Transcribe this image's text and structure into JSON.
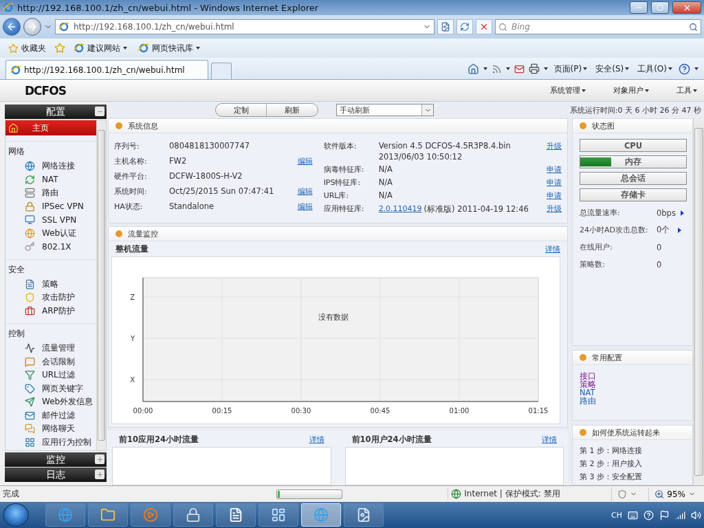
{
  "window": {
    "title": "http://192.168.100.1/zh_cn/webui.html - Windows Internet Explorer"
  },
  "browser": {
    "address": "http://192.168.100.1/zh_cn/webui.html",
    "search_placeholder": "Bing",
    "favorites_label": "收藏夹",
    "favorites_links": [
      {
        "label": "建议网站"
      },
      {
        "label": "网页快讯库"
      }
    ],
    "tabs": [
      {
        "label": "http://192.168.100.1/zh_cn/webui.html",
        "selected": true
      }
    ],
    "commands": [
      "页面(P)",
      "安全(S)",
      "工具(O)"
    ]
  },
  "app": {
    "logo": "DCFOS",
    "menus": [
      "系统管理",
      "对象用户",
      "工具"
    ],
    "uptime": "系统运行时间:0 天 6 小时 26 分 47 秒"
  },
  "sidebar": {
    "sections": [
      {
        "title": "配置",
        "expanded": true,
        "home": {
          "label": "主页",
          "selected": true
        },
        "groups": [
          {
            "title": "网络",
            "items": [
              {
                "label": "网络连接",
                "selected": false
              },
              {
                "label": "NAT",
                "selected": false
              },
              {
                "label": "路由",
                "selected": false
              },
              {
                "label": "IPSec VPN",
                "selected": false
              },
              {
                "label": "SSL VPN",
                "selected": false
              },
              {
                "label": "Web认证",
                "selected": false
              },
              {
                "label": "802.1X",
                "selected": false
              }
            ]
          },
          {
            "title": "安全",
            "items": [
              {
                "label": "策略",
                "selected": false
              },
              {
                "label": "攻击防护",
                "selected": false
              },
              {
                "label": "ARP防护",
                "selected": false
              }
            ]
          },
          {
            "title": "控制",
            "items": [
              {
                "label": "流量管理",
                "selected": false
              },
              {
                "label": "会话限制",
                "selected": false
              },
              {
                "label": "URL过滤",
                "selected": false
              },
              {
                "label": "网页关键字",
                "selected": false
              },
              {
                "label": "Web外发信息",
                "selected": false
              },
              {
                "label": "邮件过滤",
                "selected": false
              },
              {
                "label": "网络聊天",
                "selected": false
              },
              {
                "label": "应用行为控制",
                "selected": false
              }
            ]
          }
        ]
      },
      {
        "title": "监控",
        "expanded": false
      },
      {
        "title": "日志",
        "expanded": false
      }
    ]
  },
  "toolbar": {
    "buttons": [
      "定制",
      "刷新"
    ],
    "refresh_mode": "手动刷新"
  },
  "system_info": {
    "title": "系统信息",
    "left": [
      {
        "label": "序列号:",
        "values": [
          "0804818130007747"
        ]
      },
      {
        "label": "主机名称:",
        "values": [
          "FW2"
        ],
        "action": "编辑"
      },
      {
        "label": "硬件平台:",
        "values": [
          "DCFW-1800S-H-V2"
        ]
      },
      {
        "label": "系统时间:",
        "values": [
          "Oct/25/2015  Sun  07:47:41"
        ],
        "action": "编辑"
      },
      {
        "label": "HA状态:",
        "values": [
          "Standalone"
        ],
        "action": "编辑"
      }
    ],
    "right": [
      {
        "label": "软件版本:",
        "values": [
          "Version 4.5 DCFOS-4.5R3P8.4.bin",
          "2013/06/03 10:50:12"
        ],
        "action": "升级"
      },
      {
        "label": "病毒特征库:",
        "values": [
          "N/A"
        ],
        "action": "申请"
      },
      {
        "label": "IPS特征库:",
        "values": [
          "N/A"
        ],
        "action": "申请"
      },
      {
        "label": "URL库:",
        "values": [
          "N/A"
        ],
        "action": "申请"
      },
      {
        "label": "应用特征库:",
        "link": "2.0.110419",
        "values": [
          "(标准版) 2011-04-19 12:46"
        ],
        "action": "升级"
      }
    ]
  },
  "traffic": {
    "title": "流量监控",
    "subtitle": "整机流量",
    "detail": "详情",
    "y_labels": [
      "Z",
      "Y",
      "X"
    ],
    "x_labels": [
      "00:00",
      "00:15",
      "00:30",
      "00:45",
      "01:00",
      "01:15"
    ],
    "empty_text": "没有数据"
  },
  "top_panels": [
    {
      "title": "前10应用24小时流量",
      "detail": "详情"
    },
    {
      "title": "前10用户24小时流量",
      "detail": "详情"
    }
  ],
  "status_panel": {
    "title": "状态图",
    "bars": [
      {
        "label": "CPU"
      },
      {
        "label": "内存",
        "level": 0.29
      },
      {
        "label": "总会话"
      },
      {
        "label": "存储卡"
      }
    ],
    "stats": [
      {
        "label": "总流量速率:",
        "value": "0bps",
        "more": true
      },
      {
        "label": "24小时AD攻击总数:",
        "value": "0个",
        "more": true
      },
      {
        "label": "在线用户:",
        "value": "0",
        "more": false
      },
      {
        "label": "策略数:",
        "value": "0",
        "more": false
      }
    ]
  },
  "common_config": {
    "title": "常用配置",
    "links": [
      {
        "label": "接口",
        "visited": true
      },
      {
        "label": "策略",
        "visited": true
      },
      {
        "label": "NAT",
        "visited": false
      },
      {
        "label": "路由",
        "visited": false
      }
    ]
  },
  "guide": {
    "title": "如何使系统运转起来",
    "steps": [
      "第 1 步：网络连接",
      "第 2 步：用户接入",
      "第 3 步：安全配置"
    ]
  },
  "status_bar": {
    "text": "完成",
    "progress": {
      "level": 0.03
    },
    "zone": "Internet | 保护模式: 禁用",
    "zoom": "95%"
  },
  "taskbar": {
    "apps": [
      {
        "selected": false
      },
      {
        "selected": false
      },
      {
        "selected": false
      },
      {
        "selected": false
      },
      {
        "selected": false
      },
      {
        "selected": false
      },
      {
        "selected": true
      },
      {
        "selected": false
      }
    ],
    "language": "CH"
  }
}
